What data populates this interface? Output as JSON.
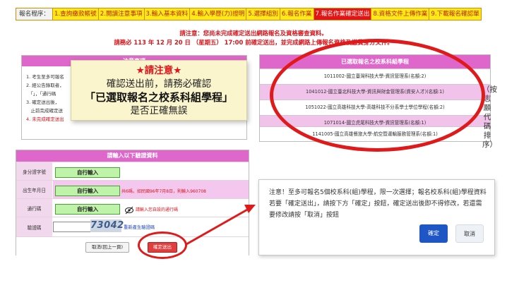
{
  "steps": {
    "label": "報名程序：",
    "items": [
      {
        "text": "1.查詢繳款帳號",
        "current": false
      },
      {
        "text": "2.閱讀注意事項",
        "current": false
      },
      {
        "text": "3.輸入基本資料",
        "current": false
      },
      {
        "text": "4.輸入學歷(力)證明",
        "current": false
      },
      {
        "text": "5.選擇組別",
        "current": false
      },
      {
        "text": "6.報名作業",
        "current": false
      },
      {
        "text": "7.報名作業確定送出",
        "current": true
      },
      {
        "text": "8.資格文件上傳作業",
        "current": false
      },
      {
        "text": "9.下載報名確認單",
        "current": false
      }
    ]
  },
  "notice": {
    "line1": "請注意：您尚未完成確定送出網路報名及資格審查資料。",
    "line2": "請務必 113 年 12 月 20 日 （星期五） 17:00 前確定送出，並完成網路上傳報名資格及繳費身分文件。"
  },
  "notes_panel": {
    "title": "注意事項",
    "lines": [
      "1. 考生至多可報名",
      "2. 經公告錄取者，",
      "　「」，「通行碼",
      "3. 確定送出後，",
      "　止前完成確定送",
      "4. 未完成確定送出"
    ]
  },
  "callout": {
    "line1": "★請注意★",
    "line2": "確認送出前，請務必確認",
    "line3": "「已選取報名之校系科組學程」",
    "line4": "是否正確無誤"
  },
  "selected_panel": {
    "title": "已選取報名之校系科組學程",
    "items": [
      "1011002-國立臺灣科技大學-資訊管理系(名額:2)",
      "1041012-國立臺北科技大學-資訊與財金管理系(資安人才)(名額:1)",
      "1051022-國立高雄科技大學-高雄科技不分系學士學位學程(名額:2)",
      "1071014-國立虎尾科技大學-資訊管理系(名額:1)",
      "1141005-國立高雄餐旅大學-航空暨運輸服務管理系(名額:1)"
    ],
    "side_note": "（按志願代碼排序）"
  },
  "form": {
    "title": "請輸入以下驗證資料",
    "id_label": "身分證字號",
    "id_button": "自行輸入",
    "dob_label": "出生年月日",
    "dob_button": "自行輸入",
    "dob_hint": "共6碼，如民國96年7月8日，則輸入960708",
    "pass_label": "通行碼",
    "pass_button": "自行輸入",
    "pass_hint": "請輸入您自設的通行碼",
    "captcha_label": "驗證碼",
    "captcha_value": "",
    "captcha_code": "73042",
    "captcha_refresh": "重新產生驗證碼",
    "cancel_label": "取消(回上一頁)",
    "submit_label": "確定送出"
  },
  "dialog": {
    "message": "注意！至多可報名5個校系科(組)學程，限一次選擇；報名校系科(組)學程資料若要「確定送出」，請按下方「確定」按鈕，確定送出後即不得修改，若還需要修改請按「取消」按鈕",
    "ok_label": "確定",
    "cancel_label": "取消"
  },
  "colors": {
    "accent_red": "#e01a1a",
    "panel_header": "#df66cb",
    "step_yellow": "#ffe816",
    "confirm_blue": "#1f56c6",
    "input_green": "#bff3a9"
  }
}
